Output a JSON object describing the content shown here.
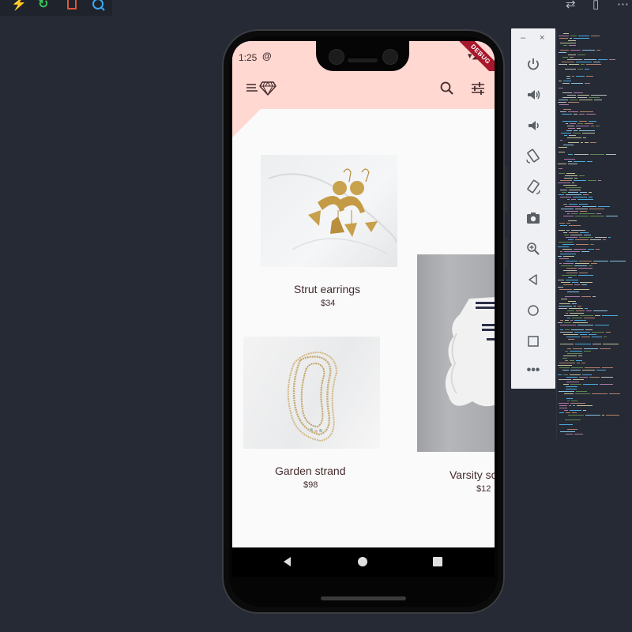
{
  "ide": {
    "toolbar_left_icons": [
      "hot-reload-icon",
      "restart-icon",
      "stop-icon",
      "inspector-icon"
    ],
    "toolbar_right_icons": [
      "compare-icon",
      "split-editor-icon",
      "more-icon"
    ]
  },
  "device": {
    "status_time": "1:25",
    "status_badge": "@",
    "status_right": "▾◢",
    "debug_banner": "DEBUG"
  },
  "app_bar": {
    "menu_icon": "menu-icon",
    "logo_icon": "diamond-icon",
    "search_icon": "search-icon",
    "filter_icon": "tune-icon"
  },
  "products": [
    {
      "name": "Strut earrings",
      "price": "$34"
    },
    {
      "name": "Garden strand",
      "price": "$98"
    },
    {
      "name": "Varsity socks",
      "price": "$12"
    }
  ],
  "nav_bar": [
    "back-icon",
    "home-icon",
    "recents-icon"
  ],
  "emulator_panel": {
    "minimize": "–",
    "close": "×",
    "buttons": [
      "power-icon",
      "volume-up-icon",
      "volume-down-icon",
      "rotate-left-icon",
      "rotate-right-icon",
      "screenshot-icon",
      "zoom-icon",
      "back-icon",
      "home-icon",
      "overview-icon",
      "more-icon"
    ]
  },
  "colors": {
    "shrine_pink": "#fed8d1",
    "shrine_brown": "#442b2d",
    "ide_background": "#252a34",
    "emulator_panel": "#eef0f3"
  }
}
